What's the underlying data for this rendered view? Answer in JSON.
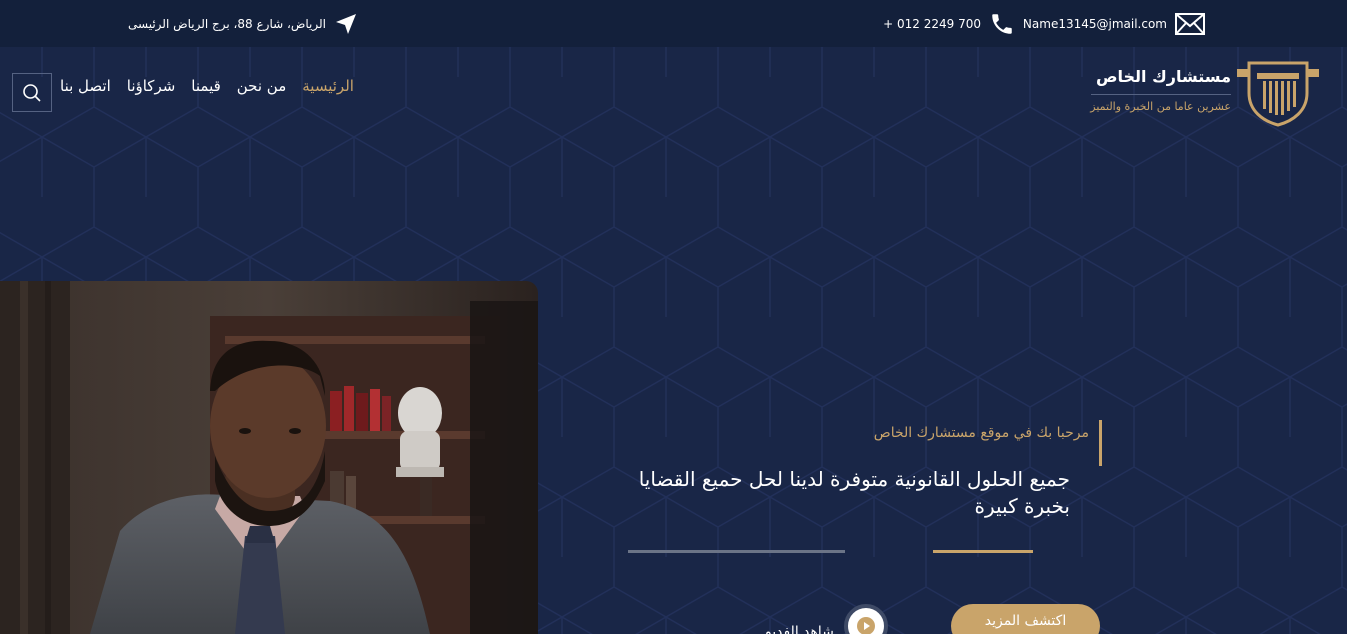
{
  "topbar": {
    "email": "Name13145@jmail.com",
    "email_icon": "envelope-icon",
    "phone": "+ 012 2249 700",
    "phone_icon": "phone-icon",
    "address": "الرياض، شارع 88، برج الرياض الرئيسى",
    "address_icon": "location-arrow-icon"
  },
  "brand": {
    "title": "مستشارك الخاص",
    "tagline": "عشرين عاما من الخبرة والتميز",
    "logo_icon": "pillar-shield-logo"
  },
  "nav": {
    "items": [
      "الرئيسية",
      "من نحن",
      "قيمنا",
      "شركاؤنا",
      "اتصل بنا"
    ],
    "active_index": 0,
    "search_icon": "search-icon"
  },
  "hero": {
    "subtitle": "مرحبا بك في موقع مستشارك الخاص",
    "title": "جميع الحلول القانونية متوفرة لدينا لحل حميع القضايا بخبرة كبيرة",
    "cta_label": "اكتشف المزيد",
    "video_label": "شاهد الفديو",
    "play_icon": "play-icon"
  },
  "colors": {
    "background": "#192647",
    "topbar": "#13203b",
    "accent": "#c9a46a",
    "text": "#ffffff"
  }
}
